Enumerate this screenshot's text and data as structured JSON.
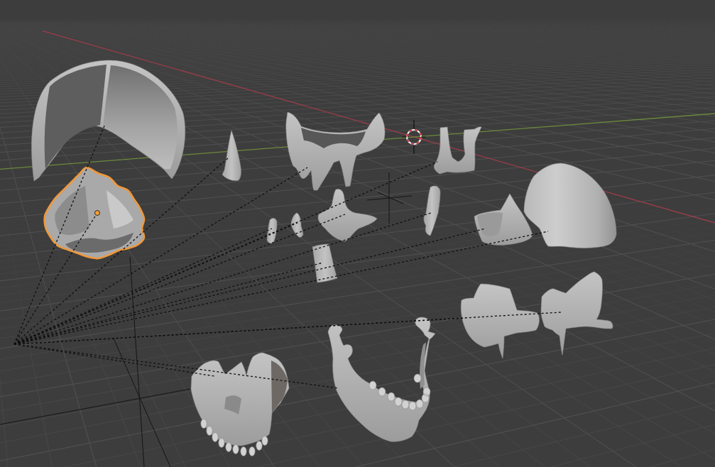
{
  "viewport": {
    "objects": [
      {
        "kind": "dome",
        "selected": false
      },
      {
        "kind": "disc",
        "selected": true
      },
      {
        "kind": "splinter",
        "selected": false
      },
      {
        "kind": "butterfly",
        "selected": false
      },
      {
        "kind": "fork",
        "selected": false
      },
      {
        "kind": "sliver",
        "selected": false
      },
      {
        "kind": "flake",
        "selected": false
      },
      {
        "kind": "crescent",
        "selected": false
      },
      {
        "kind": "peg",
        "selected": false
      },
      {
        "kind": "scroll",
        "selected": false
      },
      {
        "kind": "wedge",
        "selected": false
      },
      {
        "kind": "shell",
        "selected": false
      },
      {
        "kind": "plate",
        "selected": false
      },
      {
        "kind": "wing",
        "selected": false
      },
      {
        "kind": "maxilla",
        "selected": false
      },
      {
        "kind": "mandible",
        "selected": false
      }
    ]
  }
}
